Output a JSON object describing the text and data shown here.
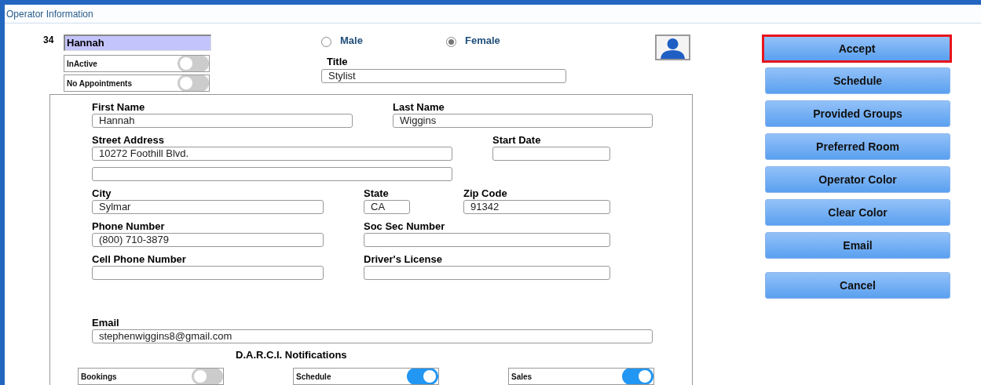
{
  "window": {
    "title": "Operator Information"
  },
  "operator": {
    "number": "34",
    "name": "Hannah"
  },
  "flags": [
    {
      "label": "InActive",
      "on": false
    },
    {
      "label": "No Appointments",
      "on": false
    }
  ],
  "gender": [
    {
      "label": "Male",
      "selected": false
    },
    {
      "label": "Female",
      "selected": true
    }
  ],
  "title_field": {
    "label": "Title",
    "value": "Stylist"
  },
  "form_rows": [
    {
      "fields": [
        {
          "label": "First Name",
          "value": "Hannah"
        },
        {
          "label": "Last Name",
          "value": "Wiggins"
        }
      ]
    },
    {
      "fields": [
        {
          "label": "Street Address",
          "value": "10272 Foothill Blvd.",
          "extra_line": true
        },
        {
          "label": "Start Date"
        }
      ]
    },
    {
      "fields": [
        {
          "label": "City",
          "value": "Sylmar"
        },
        {
          "label": "State",
          "value": "CA"
        },
        {
          "label": "Zip Code",
          "value": "91342"
        }
      ]
    },
    {
      "fields": [
        {
          "label": "Phone Number",
          "value": "(800) 710-3879"
        },
        {
          "label": "Soc Sec Number"
        }
      ]
    },
    {
      "fields": [
        {
          "label": "Cell Phone Number"
        },
        {
          "label": "Driver's License"
        }
      ]
    },
    {
      "fields": [
        {
          "label": "Email",
          "value": "stephenwiggins8@gmail.com"
        }
      ]
    }
  ],
  "notifications": {
    "heading": "D.A.R.C.I. Notifications",
    "toggles": [
      {
        "label": "Bookings",
        "on": false
      },
      {
        "label": "Schedule",
        "on": true
      },
      {
        "label": "Sales",
        "on": true
      }
    ]
  },
  "buttons": [
    {
      "label": "Accept",
      "focused": true
    },
    {
      "label": "Schedule",
      "focused": false
    },
    {
      "label": "Provided Groups",
      "focused": false
    },
    {
      "label": "Preferred Room",
      "focused": false
    },
    {
      "label": "Operator Color",
      "focused": false
    },
    {
      "label": "Clear Color",
      "focused": false
    },
    {
      "label": "Email",
      "focused": false
    }
  ],
  "cancel_button": {
    "label": "Cancel"
  }
}
